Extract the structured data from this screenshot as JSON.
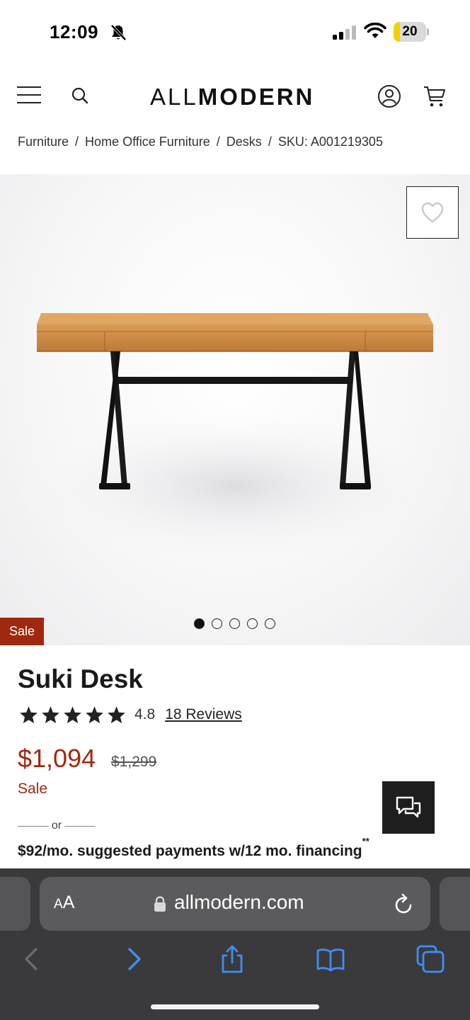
{
  "status_bar": {
    "time": "12:09",
    "battery_level": "20",
    "battery_fraction": 0.2,
    "icons": [
      "bell-slash-icon",
      "cellular-signal-icon",
      "wifi-icon",
      "battery-icon"
    ]
  },
  "header": {
    "logo_part1": "ALL",
    "logo_part2": "MODERN",
    "icons": [
      "hamburger-menu-icon",
      "search-icon",
      "account-icon",
      "cart-icon"
    ]
  },
  "breadcrumb": {
    "items": [
      "Furniture",
      "Home Office Furniture",
      "Desks"
    ],
    "separator": "/",
    "sku": "SKU: A001219305"
  },
  "gallery": {
    "sale_tag": "Sale",
    "image_count": 5,
    "active_index": 0
  },
  "product": {
    "title": "Suki Desk",
    "rating": "4.8",
    "rating_value": 4.8,
    "stars_max": 5,
    "reviews_link": "18 Reviews",
    "price": "$1,094",
    "was_price": "$1,299",
    "sale_label": "Sale",
    "or_text": "or",
    "financing": "$92/mo. suggested payments w/12 mo. financing",
    "financing_mark": "**"
  },
  "browser": {
    "aa_small": "A",
    "aa_large": "A",
    "domain": "allmodern.com"
  },
  "colors": {
    "sale_red": "#a0280f",
    "battery_yellow": "#f5d000",
    "safari_bar": "#3a3a3c",
    "safari_accent": "#3f8ef5"
  }
}
